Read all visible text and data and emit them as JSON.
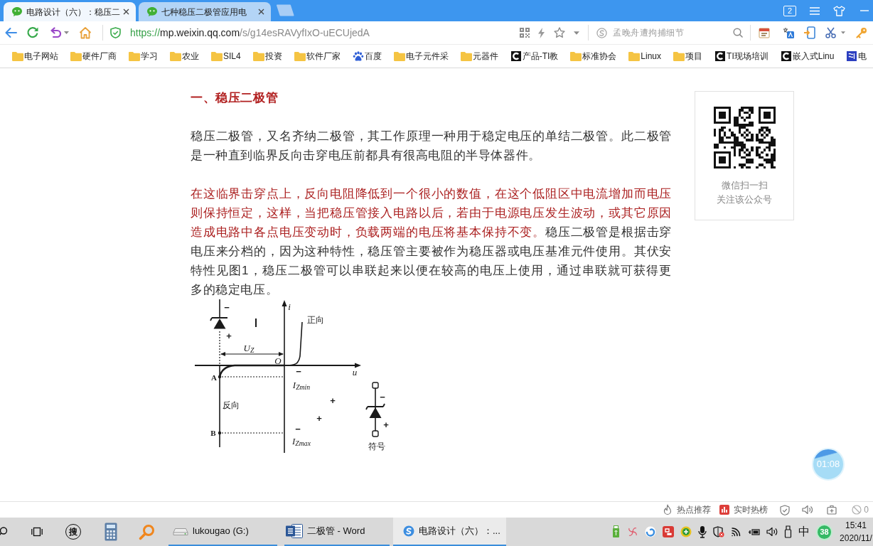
{
  "tabs": [
    {
      "title": "电路设计（六）：稳压二",
      "selected": true
    },
    {
      "title": "七种稳压二极管应用电",
      "selected": false
    }
  ],
  "window_controls": {
    "tab_count": "2"
  },
  "address_bar": {
    "scheme": "https://",
    "host": "mp.weixin.qq.com",
    "path": "/s/g14esRAVyfIxO-uECUjedA"
  },
  "search": {
    "placeholder": "孟晚舟遭拘捕细节"
  },
  "bookmarks": [
    {
      "label": "电子网站",
      "kind": "folder"
    },
    {
      "label": "硬件厂商",
      "kind": "folder"
    },
    {
      "label": "学习",
      "kind": "folder"
    },
    {
      "label": "农业",
      "kind": "folder"
    },
    {
      "label": "SIL4",
      "kind": "folder"
    },
    {
      "label": "投资",
      "kind": "folder"
    },
    {
      "label": "软件厂家",
      "kind": "folder"
    },
    {
      "label": "百度",
      "kind": "paw"
    },
    {
      "label": "电子元件采",
      "kind": "folder"
    },
    {
      "label": "元器件",
      "kind": "folder"
    },
    {
      "label": "产品-TI教",
      "kind": "letter"
    },
    {
      "label": "标准协会",
      "kind": "folder"
    },
    {
      "label": "Linux",
      "kind": "folder"
    },
    {
      "label": "项目",
      "kind": "folder"
    },
    {
      "label": "TI现场培训",
      "kind": "letter"
    },
    {
      "label": "嵌入式Linu",
      "kind": "letter"
    },
    {
      "label": "电",
      "kind": "tile"
    }
  ],
  "article": {
    "blocks": [
      {
        "kind": "heading",
        "text": "一、稳压二极管"
      },
      {
        "kind": "paragraph",
        "runs": [
          {
            "text": "稳压二极管，又名齐纳二极管，其工作原理一种用于稳定电压的单结二极管。此二极管是一种直到临界反向击穿电压前都具有很高电阻的半导体器件。",
            "emphasis": false
          }
        ]
      },
      {
        "kind": "paragraph",
        "runs": [
          {
            "text": "在这临界击穿点上，反向电阻降低到一个很小的数值，在这个低阻区中电流增加而电压则保持恒定，这样，当把稳压管接入电路以后，若由于电源电压发生波动，或其它原因造成电路中各点电压变动时，负载两端的电压将基本保持不变。",
            "emphasis": true
          },
          {
            "text": "稳压二极管是根据击穿电压来分档的，因为这种特性，稳压管主要被作为稳压器或电压基准元件使用。其伏安特性见图1，稳压二极管可以串联起来以便在较高的电压上使用，通过串联就可获得更多的稳定电压。",
            "emphasis": false
          }
        ]
      },
      {
        "kind": "figure",
        "labels": [
          {
            "text": "i",
            "kind": "symbol"
          },
          {
            "text": "−",
            "kind": "sign"
          },
          {
            "text": "正向",
            "kind": "caption"
          },
          {
            "text": "+",
            "kind": "sign"
          },
          {
            "text": "U$_{Z}$",
            "kind": "symbol"
          },
          {
            "text": "O",
            "kind": "symbol"
          },
          {
            "text": "−",
            "kind": "sign"
          },
          {
            "text": "u",
            "kind": "symbol"
          },
          {
            "text": "A",
            "kind": "point"
          },
          {
            "text": "I$_{Zmin}$",
            "kind": "symbol"
          },
          {
            "text": "−",
            "kind": "sign"
          },
          {
            "text": "+",
            "kind": "sign"
          },
          {
            "text": "反向",
            "kind": "caption"
          },
          {
            "text": "+",
            "kind": "sign"
          },
          {
            "text": "+",
            "kind": "sign"
          },
          {
            "text": "−",
            "kind": "sign"
          },
          {
            "text": "B",
            "kind": "point"
          },
          {
            "text": "I$_{Zmax}$",
            "kind": "symbol"
          },
          {
            "text": "符号",
            "kind": "caption"
          }
        ]
      }
    ]
  },
  "qr_panel": {
    "lines": [
      "微信扫一扫",
      "关注该公众号"
    ]
  },
  "timer": {
    "text": "01:08"
  },
  "status_bar": {
    "links": [
      {
        "label": "热点推荐",
        "kind": "hot"
      },
      {
        "label": "实时热榜",
        "kind": "chart"
      }
    ],
    "ad_block_count": "0"
  },
  "taskbar": {
    "pinned": [
      {
        "kind": "search"
      },
      {
        "kind": "taskview"
      },
      {
        "kind": "glyph",
        "glyph": "搜"
      },
      {
        "kind": "calculator"
      },
      {
        "kind": "lens"
      }
    ],
    "apps": [
      {
        "label": "lukougao (G:)",
        "kind": "drive",
        "selected": false
      },
      {
        "label": "二极管 - Word",
        "kind": "document",
        "selected": false
      },
      {
        "label": "电路设计（六）：...",
        "kind": "browser",
        "selected": true
      }
    ],
    "ime": "中",
    "badge": "38",
    "time": "15:41",
    "date": "2020/11/"
  }
}
